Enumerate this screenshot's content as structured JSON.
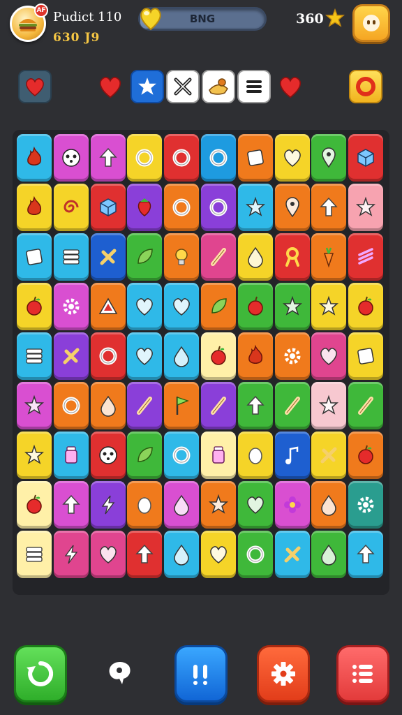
{
  "hud": {
    "player_name": "Pudict 110",
    "player_score": "630 J9",
    "avatar_badge": "AF",
    "progress_label": "BNG",
    "progress_fraction": 0.1,
    "coins": "360"
  },
  "toolbar": {
    "items": [
      "heart-box-icon",
      "heart-icon",
      "star-icon",
      "close-icon",
      "food-icon",
      "list-icon",
      "heart-icon",
      "ring-icon"
    ]
  },
  "board": {
    "rows": 9,
    "cols": 10,
    "tiles": [
      [
        "#2fb9e8:flame",
        "#d94fd1:face",
        "#d94fd1:arrow",
        "#f5d428:ring",
        "#e03030:ring",
        "#1e9be0:ring",
        "#f07a1c:square",
        "#f5d428:heart",
        "#3fb83a:pin",
        "#e03030:cube"
      ],
      [
        "#f5d428:flame",
        "#f5d428:swirl",
        "#e03030:cube",
        "#8a3fd9:strawberry",
        "#f07a1c:ring",
        "#8a3fd9:ring",
        "#2fb9e8:star",
        "#f07a1c:pin",
        "#f07a1c:arrow",
        "#f7a3b0:star"
      ],
      [
        "#2fb9e8:square",
        "#2fb9e8:layers",
        "#1e5fd0:cross",
        "#3fb83a:leaf",
        "#f07a1c:bulb",
        "#e0458f:stick",
        "#f5d428:drop",
        "#e03030:ribbon",
        "#f07a1c:carrot",
        "#e03030:stripes"
      ],
      [
        "#f5d428:apple",
        "#d94fd1:gear",
        "#f07a1c:triangle",
        "#2fb9e8:heart",
        "#2fb9e8:heart",
        "#f07a1c:leaf",
        "#3fb83a:apple",
        "#3fb83a:star",
        "#f5d428:star",
        "#f5d428:apple"
      ],
      [
        "#2fb9e8:layers",
        "#8a3fd9:cross",
        "#e03030:ring",
        "#2fb9e8:heart",
        "#2fb9e8:drop",
        "#fff0a8:apple",
        "#f07a1c:flame",
        "#f07a1c:gear",
        "#e0458f:heart",
        "#f5d428:square"
      ],
      [
        "#d94fd1:star",
        "#f07a1c:ring",
        "#f07a1c:drop",
        "#8a3fd9:stick",
        "#f07a1c:flag",
        "#8a3fd9:stick",
        "#3fb83a:arrow",
        "#3fb83a:stick",
        "#f7c8d0:star",
        "#3fb83a:stick"
      ],
      [
        "#f5d428:star",
        "#2fb9e8:jar",
        "#e03030:face",
        "#3fb83a:leaf",
        "#2fb9e8:ring",
        "#fff0a8:jar",
        "#f5d428:egg",
        "#1e5fd0:note",
        "#f5d428:cross",
        "#f07a1c:apple"
      ],
      [
        "#fff0a8:apple",
        "#d94fd1:arrow",
        "#8a3fd9:bolt",
        "#f07a1c:egg",
        "#d94fd1:drop",
        "#f07a1c:star",
        "#3fb83a:heart",
        "#d94fd1:flower",
        "#f07a1c:drop",
        "#2a9d8f:gear"
      ],
      [
        "#fff0a8:layers",
        "#e0458f:bolt",
        "#e0458f:heart",
        "#e03030:arrow",
        "#2fb9e8:drop",
        "#f5d428:heart",
        "#3fb83a:ring",
        "#2fb9e8:cross",
        "#3fb83a:drop",
        "#2fb9e8:arrow"
      ]
    ]
  },
  "bottom_bar": {
    "items": [
      "refresh-icon",
      "hint-icon",
      "pause-icon",
      "settings-icon",
      "menu-list-icon"
    ]
  }
}
